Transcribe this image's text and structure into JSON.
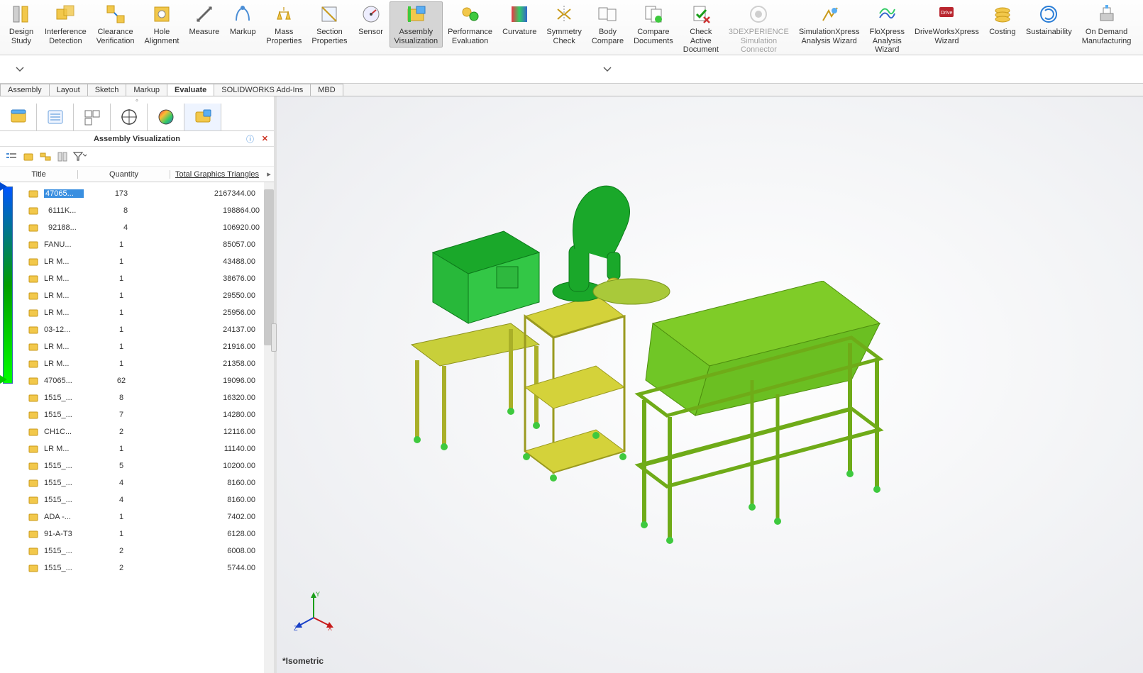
{
  "ribbon": {
    "items": [
      {
        "key": "design-study",
        "label": "Design\nStudy"
      },
      {
        "key": "interference-detection",
        "label": "Interference\nDetection"
      },
      {
        "key": "clearance-verification",
        "label": "Clearance\nVerification"
      },
      {
        "key": "hole-alignment",
        "label": "Hole\nAlignment"
      },
      {
        "key": "measure",
        "label": "Measure"
      },
      {
        "key": "markup",
        "label": "Markup"
      },
      {
        "key": "mass-properties",
        "label": "Mass\nProperties"
      },
      {
        "key": "section-properties",
        "label": "Section\nProperties"
      },
      {
        "key": "sensor",
        "label": "Sensor"
      },
      {
        "key": "assembly-visualization",
        "label": "Assembly\nVisualization",
        "active": true
      },
      {
        "key": "performance-evaluation",
        "label": "Performance\nEvaluation"
      },
      {
        "key": "curvature",
        "label": "Curvature"
      },
      {
        "key": "symmetry-check",
        "label": "Symmetry\nCheck"
      },
      {
        "key": "body-compare",
        "label": "Body\nCompare"
      },
      {
        "key": "compare-documents",
        "label": "Compare\nDocuments"
      },
      {
        "key": "check-active-document",
        "label": "Check\nActive\nDocument"
      },
      {
        "key": "3dexperience",
        "label": "3DEXPERIENCE\nSimulation\nConnector",
        "disabled": true
      },
      {
        "key": "simulationxpress",
        "label": "SimulationXpress\nAnalysis Wizard"
      },
      {
        "key": "floxpress",
        "label": "FloXpress\nAnalysis\nWizard"
      },
      {
        "key": "driveworksxpress",
        "label": "DriveWorksXpress\nWizard"
      },
      {
        "key": "costing",
        "label": "Costing"
      },
      {
        "key": "sustainability",
        "label": "Sustainability"
      },
      {
        "key": "on-demand-manufacturing",
        "label": "On Demand\nManufacturing"
      }
    ]
  },
  "tabs": {
    "items": [
      "Assembly",
      "Layout",
      "Sketch",
      "Markup",
      "Evaluate",
      "SOLIDWORKS Add-Ins",
      "MBD"
    ],
    "active_index": 4
  },
  "panel": {
    "title": "Assembly Visualization",
    "columns": {
      "title": "Title",
      "qty": "Quantity",
      "triangles": "Total Graphics Triangles"
    },
    "rows": [
      {
        "title": "47065...",
        "qty": "173",
        "tri": "2167344.00",
        "selected": true
      },
      {
        "title": "6111K...",
        "qty": "8",
        "tri": "198864.00",
        "indent": true
      },
      {
        "title": "92188...",
        "qty": "4",
        "tri": "106920.00",
        "indent": true
      },
      {
        "title": "FANU...",
        "qty": "1",
        "tri": "85057.00"
      },
      {
        "title": "LR M...",
        "qty": "1",
        "tri": "43488.00"
      },
      {
        "title": "LR M...",
        "qty": "1",
        "tri": "38676.00"
      },
      {
        "title": "LR M...",
        "qty": "1",
        "tri": "29550.00"
      },
      {
        "title": "LR M...",
        "qty": "1",
        "tri": "25956.00"
      },
      {
        "title": "03-12...",
        "qty": "1",
        "tri": "24137.00"
      },
      {
        "title": "LR M...",
        "qty": "1",
        "tri": "21916.00"
      },
      {
        "title": "LR M...",
        "qty": "1",
        "tri": "21358.00"
      },
      {
        "title": "47065...",
        "qty": "62",
        "tri": "19096.00"
      },
      {
        "title": "1515_...",
        "qty": "8",
        "tri": "16320.00"
      },
      {
        "title": "1515_...",
        "qty": "7",
        "tri": "14280.00"
      },
      {
        "title": "CH1C...",
        "qty": "2",
        "tri": "12116.00"
      },
      {
        "title": "LR M...",
        "qty": "1",
        "tri": "11140.00"
      },
      {
        "title": "1515_...",
        "qty": "5",
        "tri": "10200.00"
      },
      {
        "title": "1515_...",
        "qty": "4",
        "tri": "8160.00"
      },
      {
        "title": "1515_...",
        "qty": "4",
        "tri": "8160.00"
      },
      {
        "title": "ADA -...",
        "qty": "1",
        "tri": "7402.00"
      },
      {
        "title": "91-A-T3",
        "qty": "1",
        "tri": "6128.00"
      },
      {
        "title": "1515_...",
        "qty": "2",
        "tri": "6008.00"
      },
      {
        "title": "1515_...",
        "qty": "2",
        "tri": "5744.00"
      }
    ]
  },
  "viewport": {
    "orientation_label": "*Isometric",
    "triad": {
      "x": "X",
      "y": "Y",
      "z": "Z"
    }
  },
  "colors": {
    "green_dark": "#1aa82a",
    "green_mid": "#3ec93e",
    "green_light": "#6fdc2f",
    "yellowgreen": "#b7d23a",
    "olive": "#c8cf3a"
  }
}
